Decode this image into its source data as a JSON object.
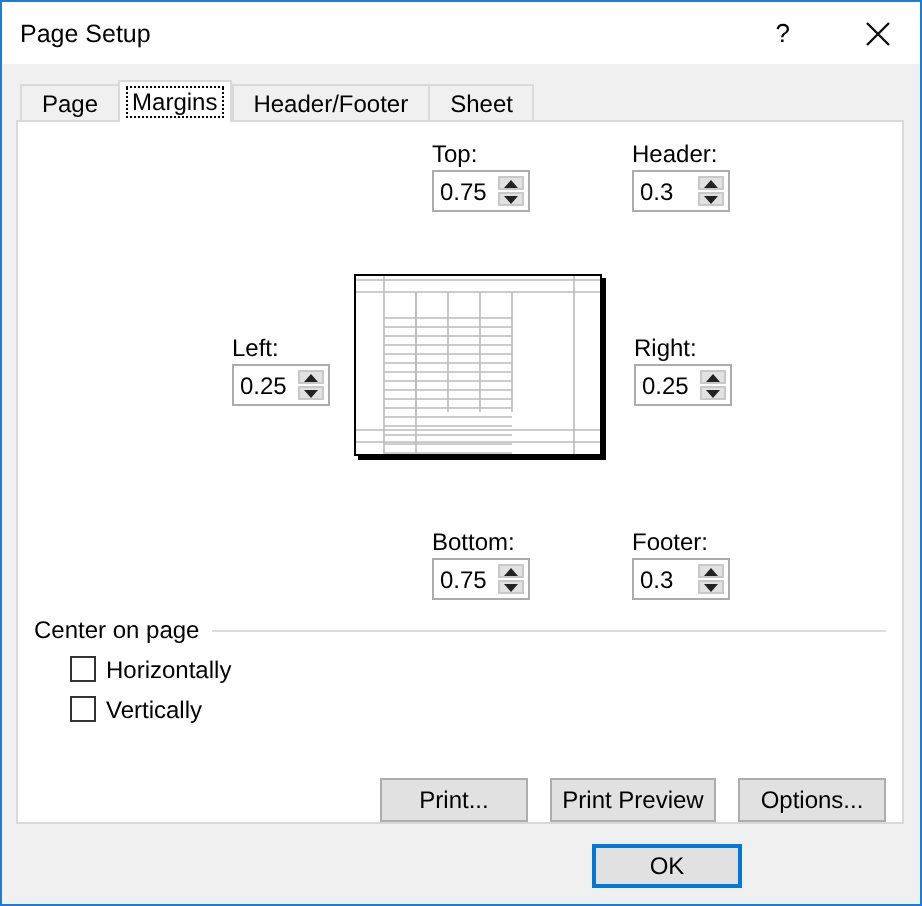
{
  "window": {
    "title": "Page Setup",
    "help": "?"
  },
  "tabs": [
    {
      "label": "Page",
      "selected": false
    },
    {
      "label": "Margins",
      "selected": true
    },
    {
      "label": "Header/Footer",
      "selected": false
    },
    {
      "label": "Sheet",
      "selected": false
    }
  ],
  "margins": {
    "top": {
      "label": "Top:",
      "value": "0.75"
    },
    "header": {
      "label": "Header:",
      "value": "0.3"
    },
    "left": {
      "label": "Left:",
      "value": "0.25"
    },
    "right": {
      "label": "Right:",
      "value": "0.25"
    },
    "bottom": {
      "label": "Bottom:",
      "value": "0.75"
    },
    "footer": {
      "label": "Footer:",
      "value": "0.3"
    }
  },
  "center_on_page": {
    "title": "Center on page",
    "options": [
      {
        "label": "Horizontally",
        "checked": false
      },
      {
        "label": "Vertically",
        "checked": false
      }
    ]
  },
  "buttons": [
    "Print...",
    "Print Preview",
    "Options..."
  ],
  "dialog_buttons": [
    {
      "label": "OK",
      "default": true
    }
  ]
}
